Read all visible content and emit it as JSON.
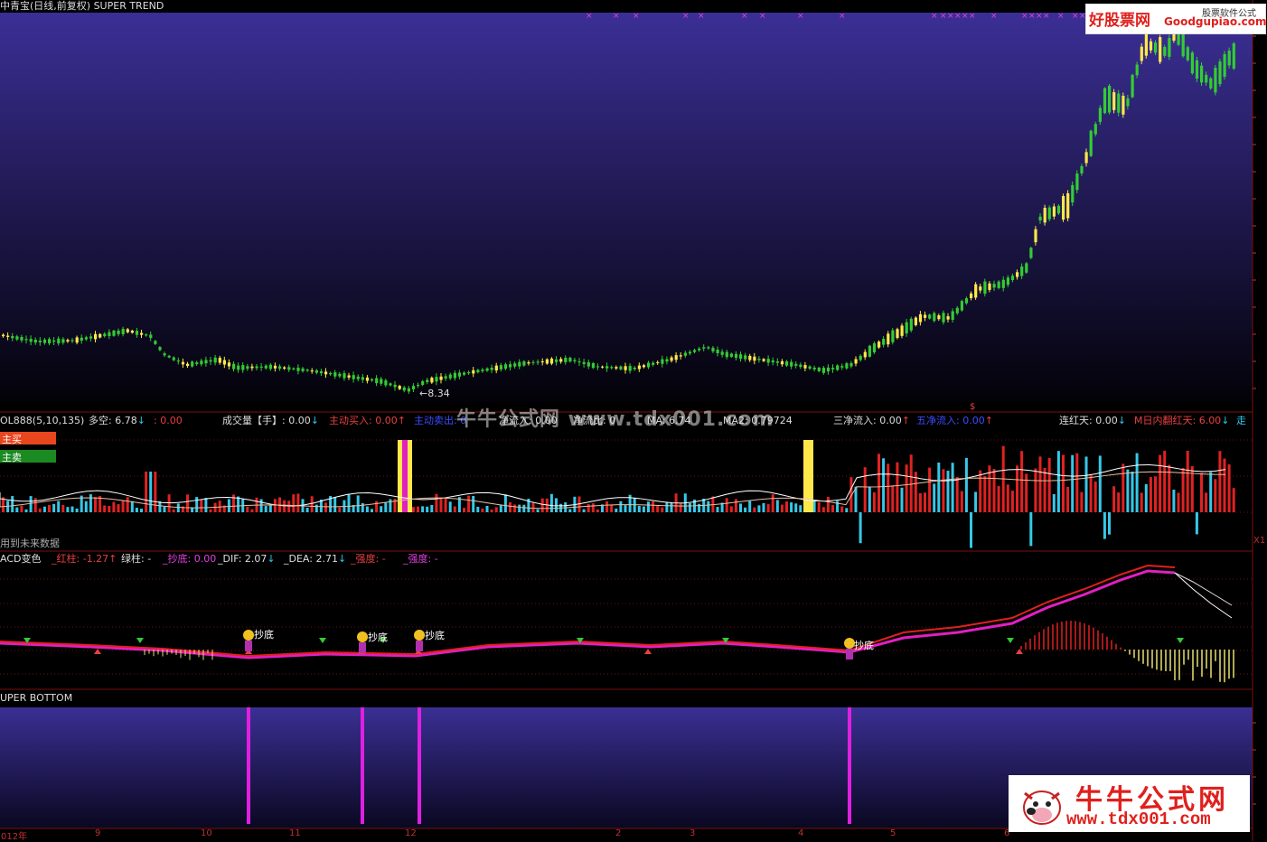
{
  "window": {
    "title": "中青宝(日线,前复权) SUPER TREND"
  },
  "watermarks": {
    "top_logo_main": "好股票网",
    "top_logo_domain": "Goodgupiao.com",
    "top_logo_sub": "股票软件公式",
    "bottom_logo_cn": "牛牛公式网",
    "bottom_logo_url": "www.tdx001.com",
    "center_text": "牛牛公式网 www.tdx001.com"
  },
  "price_panel": {
    "low_label": "8.34",
    "dollar_mark": "$"
  },
  "volume_panel": {
    "items": [
      {
        "label": "OL888(5,10,135)",
        "color": "#dddddd"
      },
      {
        "label": "多空: 6.78",
        "color": "#dddddd",
        "arrow": "↓",
        "arrow_color": "#29c7e8"
      },
      {
        "label": ": 0.00",
        "color": "#e84040"
      },
      {
        "label": "成交量【手】: 0.00",
        "color": "#dddddd",
        "arrow": "↓",
        "arrow_color": "#29c7e8"
      },
      {
        "label": "主动买入: 0.00",
        "color": "#e84040",
        "arrow": "↑",
        "arrow_color": "#e84040"
      },
      {
        "label": "主动卖出: 0",
        "color": "#3a4cff"
      },
      {
        "label": "净流入: 0.00",
        "color": "#dddddd"
      },
      {
        "label": "净流比: 0",
        "color": "#dddddd"
      },
      {
        "label": "MA: 6.74",
        "color": "#dddddd"
      },
      {
        "label": "MA2: 0.79724",
        "color": "#dddddd"
      },
      {
        "label": "三净流入: 0.00",
        "color": "#dddddd",
        "arrow": "↑",
        "arrow_color": "#e84040"
      },
      {
        "label": "五净流入: 0.00",
        "color": "#3a4cff",
        "arrow": "↑",
        "arrow_color": "#e84040"
      },
      {
        "label": "连红天: 0.00",
        "color": "#dddddd",
        "arrow": "↓",
        "arrow_color": "#29c7e8"
      },
      {
        "label": "M日内翻红天: 6.00",
        "color": "#e84040",
        "arrow": "↓",
        "arrow_color": "#29c7e8"
      },
      {
        "label": "走",
        "color": "#29c7e8"
      }
    ],
    "tag_buy": "主买",
    "tag_sell": "主卖",
    "future_note": "用到未来数据"
  },
  "macd_panel": {
    "items": [
      {
        "label": "ACD变色",
        "color": "#dddddd"
      },
      {
        "label": "_红柱: -1.27",
        "color": "#e84040",
        "arrow": "↑",
        "arrow_color": "#e84040"
      },
      {
        "label": "绿柱: -",
        "color": "#dddddd"
      },
      {
        "label": "_抄底: 0.00",
        "color": "#e040e0"
      },
      {
        "label": "_DIF: 2.07",
        "color": "#dddddd",
        "arrow": "↓",
        "arrow_color": "#29c7e8"
      },
      {
        "label": "_DEA: 2.71",
        "color": "#dddddd",
        "arrow": "↓",
        "arrow_color": "#29c7e8"
      },
      {
        "label": "_强度: -",
        "color": "#e84040"
      },
      {
        "label": "_强度: -",
        "color": "#e040e0"
      }
    ],
    "signal_label": "抄底"
  },
  "bottom_panel": {
    "title": "UPER BOTTOM"
  },
  "time_axis": {
    "labels": [
      "012年",
      "9",
      "10",
      "11",
      "12",
      "2",
      "3",
      "4",
      "5",
      "6"
    ]
  },
  "right_axis": {
    "marker": "X1"
  },
  "colors": {
    "up_candle": "#ffe84a",
    "down_candle": "#33cc33",
    "buy_bar": "#e02222",
    "sell_bar": "#36c8e8",
    "pink_line": "#e020c0",
    "red_line": "#e02020",
    "bottom_signal": "#e020e0",
    "price_bg_top": "#3a2f94",
    "price_bg_bottom": "#000000"
  }
}
